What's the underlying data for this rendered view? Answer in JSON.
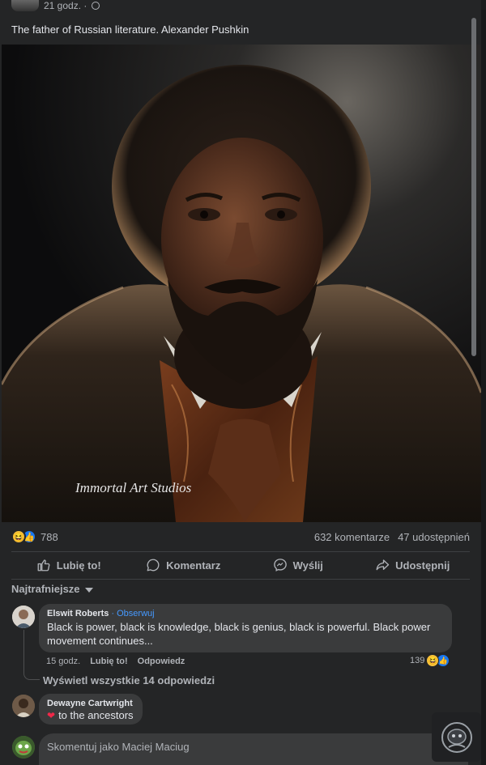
{
  "post": {
    "timestamp": "21 godz. ·",
    "caption": "The father of Russian literature. Alexander Pushkin",
    "watermark": "Immortal Art Studios"
  },
  "reactions": {
    "count": "788",
    "comments": "632 komentarze",
    "shares": "47 udostępnień",
    "icons": [
      "haha-icon",
      "like-icon"
    ]
  },
  "actions": {
    "like": "Lubię to!",
    "comment": "Komentarz",
    "send": "Wyślij",
    "share": "Udostępnij"
  },
  "sort": {
    "label": "Najtrafniejsze"
  },
  "comments": [
    {
      "author": "Elswit Roberts",
      "follow": "· Obserwuj",
      "text": "Black is power, black is knowledge, black is genius, black is powerful. Black power movement continues...",
      "time": "15 godz.",
      "like": "Lubię to!",
      "reply": "Odpowiedz",
      "reaction_count": "139"
    },
    {
      "author": "Dewayne Cartwright",
      "text": "to the ancestors"
    }
  ],
  "view_replies": "Wyświetl wszystkie 14 odpowiedzi",
  "composer": {
    "placeholder": "Skomentuj jako Maciej Maciug"
  },
  "colors": {
    "background": "#242526",
    "bubble": "#3a3b3c",
    "accent": "#1877f2",
    "link": "#4599ff",
    "heart": "#f02849"
  }
}
